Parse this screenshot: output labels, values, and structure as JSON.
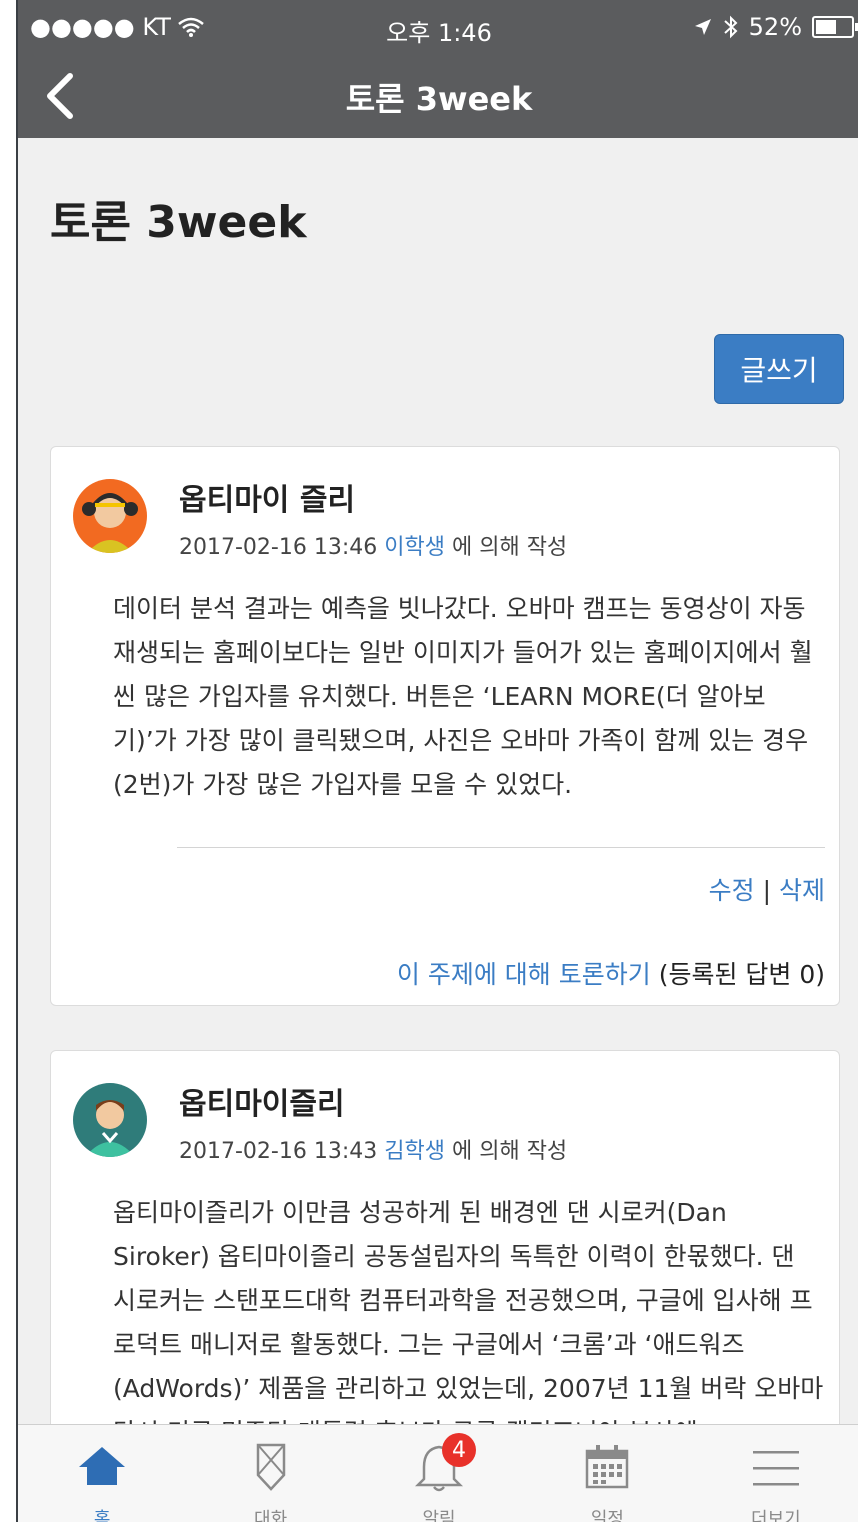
{
  "status_bar": {
    "carrier": "●●●●● KT",
    "time": "오후 1:46",
    "battery": "52%",
    "battery_level": 0.52
  },
  "nav": {
    "title": "토론 3week"
  },
  "page": {
    "title": "토론 3week",
    "write_button": "글쓰기"
  },
  "posts": [
    {
      "title": "옵티마이 즐리",
      "date": "2017-02-16 13:46",
      "author": "이학생",
      "written_by": "에 의해 작성",
      "body": "데이터 분석 결과는 예측을 빗나갔다. 오바마 캠프는 동영상이 자동 재생되는 홈페이보다는 일반 이미지가 들어가 있는 홈페이지에서 훨씬 많은 가입자를 유치했다. 버튼은 ‘LEARN MORE(더 알아보기)’가 가장 많이 클릭됐으며, 사진은 오바마 가족이 함께 있는 경우(2번)가 가장 많은 가입자를 모을 수 있었다.",
      "edit": "수정",
      "separator": "|",
      "delete": "삭제",
      "discuss": "이 주제에 대해 토론하기",
      "reply_count": "(등록된 답변 0)"
    },
    {
      "title": "옵티마이즐리",
      "date": "2017-02-16 13:43",
      "author": "김학생",
      "written_by": "에 의해 작성",
      "body": "옵티마이즐리가 이만큼 성공하게 된 배경엔 댄 시로커(Dan Siroker) 옵티마이즐리 공동설립자의 독특한 이력이 한몫했다. 댄 시로커는 스탠포드대학 컴퓨터과학을 전공했으며, 구글에 입사해 프로덕트 매니저로 활동했다. 그는 구글에서 ‘크롬’과 ‘애드워즈(AdWords)’ 제품을 관리하고 있었는데, 2007년 11월 버락 오바마 당시 미국 민주당 대통령 후보가 구글 캘리포니아 본사에"
    }
  ],
  "tabs": [
    {
      "label": "홈",
      "icon": "home-icon",
      "active": true
    },
    {
      "label": "대화",
      "icon": "chat-icon"
    },
    {
      "label": "알림",
      "icon": "bell-icon",
      "badge": "4"
    },
    {
      "label": "일정",
      "icon": "calendar-icon"
    },
    {
      "label": "더보기",
      "icon": "menu-icon"
    }
  ],
  "colors": {
    "accent": "#3b7dc4",
    "header": "#5b5c5e",
    "badge": "#e8312a"
  }
}
